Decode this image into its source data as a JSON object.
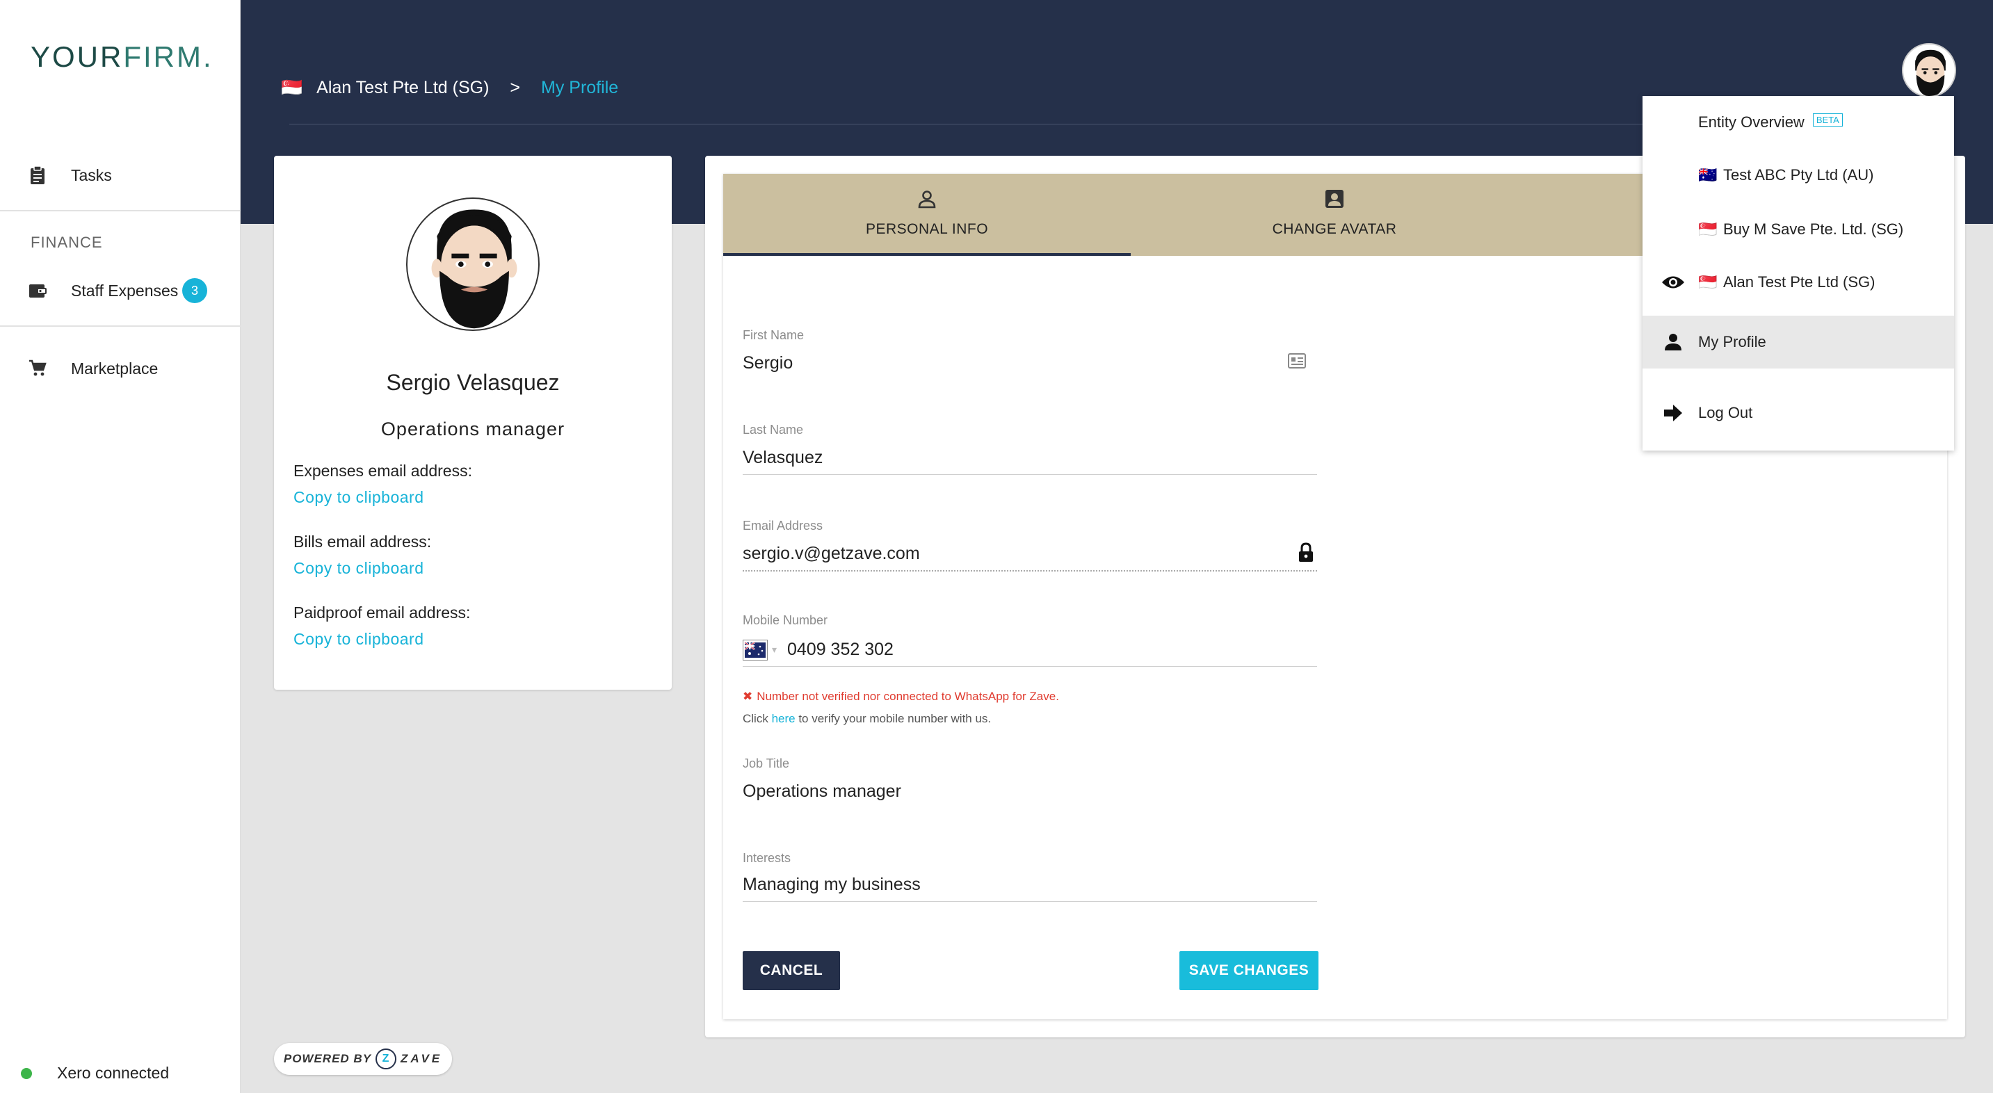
{
  "app": {
    "logo_bold": "YOUR",
    "logo_light": "FIRM."
  },
  "sidebar": {
    "tasks_label": "Tasks",
    "finance_section": "FINANCE",
    "staff_expenses_label": "Staff Expenses",
    "staff_expenses_count": "3",
    "marketplace_label": "Marketplace",
    "xero_status": "Xero connected"
  },
  "header": {
    "entity_flag": "🇸🇬",
    "entity_name": "Alan Test Pte Ltd (SG)",
    "separator": ">",
    "current_page": "My Profile"
  },
  "profile": {
    "name": "Sergio Velasquez",
    "title": "Operations manager",
    "expenses_email_label": "Expenses email address:",
    "bills_email_label": "Bills email address:",
    "paidproof_email_label": "Paidproof email address:",
    "copy_label": "Copy to clipboard"
  },
  "tabs": {
    "personal_info": "PERSONAL INFO",
    "change_avatar": "CHANGE AVATAR"
  },
  "form": {
    "first_name_label": "First Name",
    "first_name": "Sergio",
    "last_name_label": "Last Name",
    "last_name": "Velasquez",
    "email_label": "Email Address",
    "email": "sergio.v@getzave.com",
    "mobile_label": "Mobile Number",
    "mobile": "0409 352 302",
    "mobile_error": "Number not verified nor connected to WhatsApp for Zave.",
    "mobile_hint_prefix": "Click ",
    "mobile_hint_link": "here",
    "mobile_hint_suffix": " to verify your mobile number with us.",
    "job_title_label": "Job Title",
    "job_title": "Operations manager",
    "interests_label": "Interests",
    "interests": "Managing my business",
    "cancel_label": "CANCEL",
    "save_label": "SAVE CHANGES"
  },
  "powered_by": {
    "prefix": "POWERED BY",
    "brand": "ZAVE"
  },
  "dropdown": {
    "entity_overview": "Entity Overview",
    "beta": "BETA",
    "entities": [
      {
        "flag": "🇦🇺",
        "name": "Test ABC Pty Ltd (AU)"
      },
      {
        "flag": "🇸🇬",
        "name": "Buy M Save Pte. Ltd. (SG)"
      },
      {
        "flag": "🇸🇬",
        "name": "Alan Test Pte Ltd (SG)"
      }
    ],
    "my_profile": "My Profile",
    "log_out": "Log Out"
  },
  "colors": {
    "navy": "#25304a",
    "accent": "#19bcdb",
    "tab_bg": "#cbbf9f",
    "error": "#e03b2f"
  }
}
